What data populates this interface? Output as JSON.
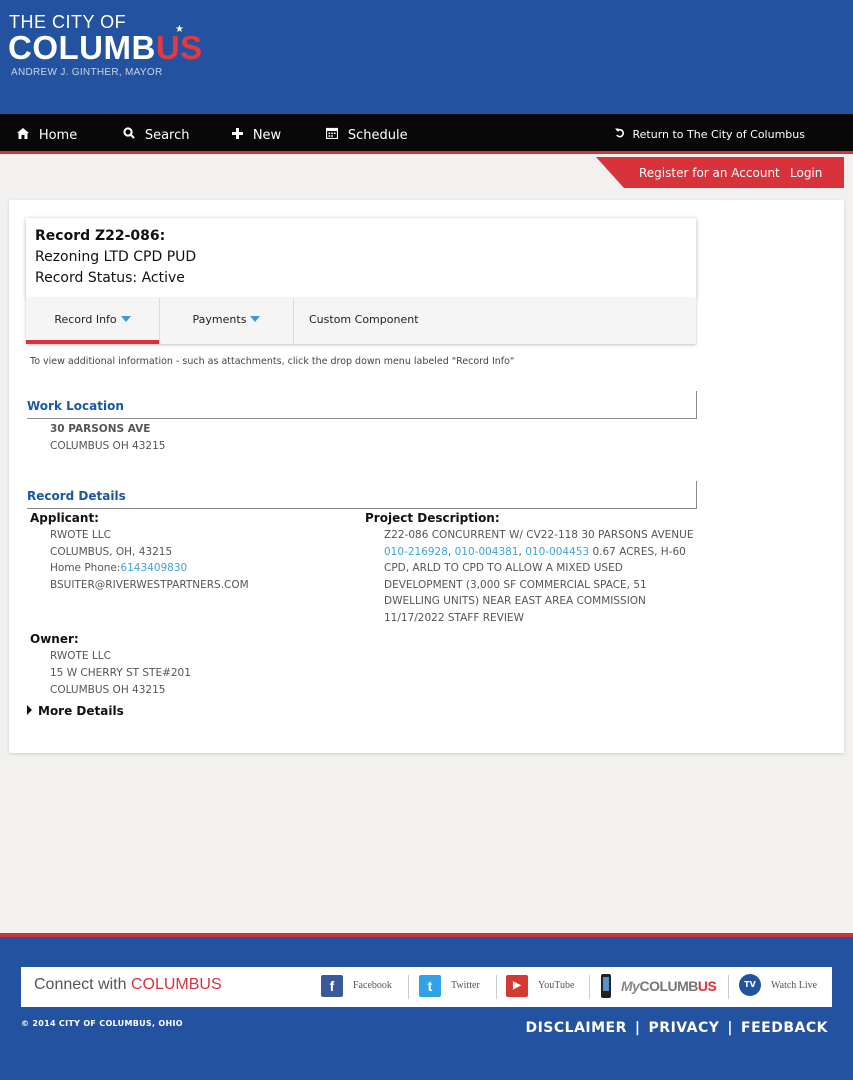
{
  "header": {
    "logo_line1": "THE CITY OF",
    "logo_line2_main": "COLUMB",
    "logo_line2_accent": "US",
    "logo_line3": "ANDREW J. GINTHER, MAYOR"
  },
  "nav": {
    "items": [
      {
        "label": "Home",
        "icon": "home-icon"
      },
      {
        "label": "Search",
        "icon": "search-icon"
      },
      {
        "label": "New",
        "icon": "plus-icon"
      },
      {
        "label": "Schedule",
        "icon": "calendar-icon"
      }
    ],
    "return_label": "Return to The City of Columbus"
  },
  "account": {
    "register_label": "Register for an Account",
    "login_label": "Login"
  },
  "record": {
    "title": "Record Z22-086:",
    "type": "Rezoning LTD CPD PUD",
    "status": "Record Status: Active"
  },
  "tabs": [
    {
      "label": "Record Info",
      "active": true,
      "has_caret": true
    },
    {
      "label": "Payments",
      "active": false,
      "has_caret": true
    },
    {
      "label": "Custom Component",
      "active": false,
      "has_caret": false
    }
  ],
  "hint": "To view additional information - such as attachments, click the drop down menu labeled \"Record Info\"",
  "work_location": {
    "heading": "Work Location",
    "address1": "30 PARSONS AVE",
    "address2": "COLUMBUS OH 43215"
  },
  "record_details": {
    "heading": "Record Details",
    "applicant": {
      "label": "Applicant:",
      "name": "RWOTE LLC",
      "city_line": "COLUMBUS, OH, 43215",
      "phone_label": "Home Phone:",
      "phone": "6143409830",
      "email": "BSUITER@RIVERWESTPARTNERS.COM"
    },
    "project": {
      "label": "Project Description:",
      "line1": "Z22-086 CONCURRENT W/ CV22-118 30 PARSONS AVENUE",
      "parcel1": "010-216928",
      "parcel2": "010-004381",
      "parcel3": "010-004453",
      "comma": ",",
      "line2_tail": "0.67 ACRES, H-60",
      "line3": "CPD, ARLD TO CPD TO ALLOW A MIXED USED",
      "line4": "DEVELOPMENT (3,000 SF COMMERCIAL SPACE, 51",
      "line5": "DWELLING UNITS) NEAR EAST AREA COMMISSION",
      "line6": "11/17/2022 STAFF REVIEW"
    },
    "owner": {
      "label": "Owner:",
      "name": "RWOTE LLC",
      "address1": "15 W CHERRY ST STE#201",
      "address2": "COLUMBUS OH 43215"
    },
    "more_details": "More Details"
  },
  "footer": {
    "connect_prefix": "Connect with",
    "connect_accent": "COLUMBUS",
    "social": [
      {
        "label": "Facebook",
        "icon": "facebook-icon",
        "glyph": "f",
        "color": "#3b5998"
      },
      {
        "label": "Twitter",
        "icon": "twitter-icon",
        "glyph": "t",
        "color": "#2fa3e6"
      },
      {
        "label": "YouTube",
        "icon": "youtube-icon",
        "glyph": "▶",
        "color": "#d33a32"
      }
    ],
    "mycolumbus_prefix": "My",
    "mycolumbus_main": "COLUMB",
    "mycolumbus_accent": "US",
    "watch_live": "Watch Live",
    "tv_glyph": "TV",
    "copyright": "© 2014 CITY OF COLUMBUS, OHIO",
    "links": [
      "DISCLAIMER",
      "PRIVACY",
      "FEEDBACK"
    ],
    "link_separator": "|"
  },
  "colors": {
    "brand_blue": "#2352a0",
    "accent_red": "#d8323b",
    "link_blue": "#3ca4dc",
    "heading_blue": "#1c56a5"
  }
}
